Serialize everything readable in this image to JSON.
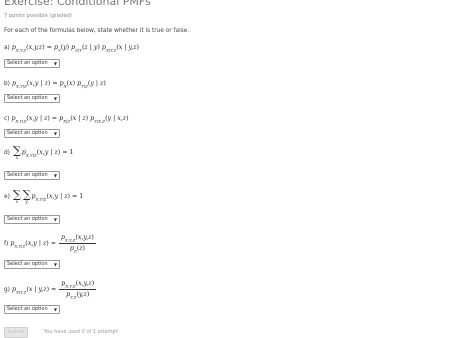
{
  "exercise": {
    "title": "Exercise: Conditional PMFs",
    "points": "7 points possible (graded)",
    "instructions": "For each of the formulas below, state whether it is true or false."
  },
  "problems": [
    {
      "label": "a)",
      "select": "Select an option"
    },
    {
      "label": "b)",
      "select": "Select an option"
    },
    {
      "label": "c)",
      "select": "Select an option"
    },
    {
      "label": "d)",
      "select": "Select an option"
    },
    {
      "label": "e)",
      "select": "Select an option"
    },
    {
      "label": "f)",
      "select": "Select an option"
    },
    {
      "label": "g)",
      "select": "Select an option"
    }
  ],
  "footer": {
    "submit_label": "Submit",
    "attempts": "You have used 0 of 1 attempt"
  },
  "icons": {
    "dropdown": "chevron-down-icon"
  }
}
